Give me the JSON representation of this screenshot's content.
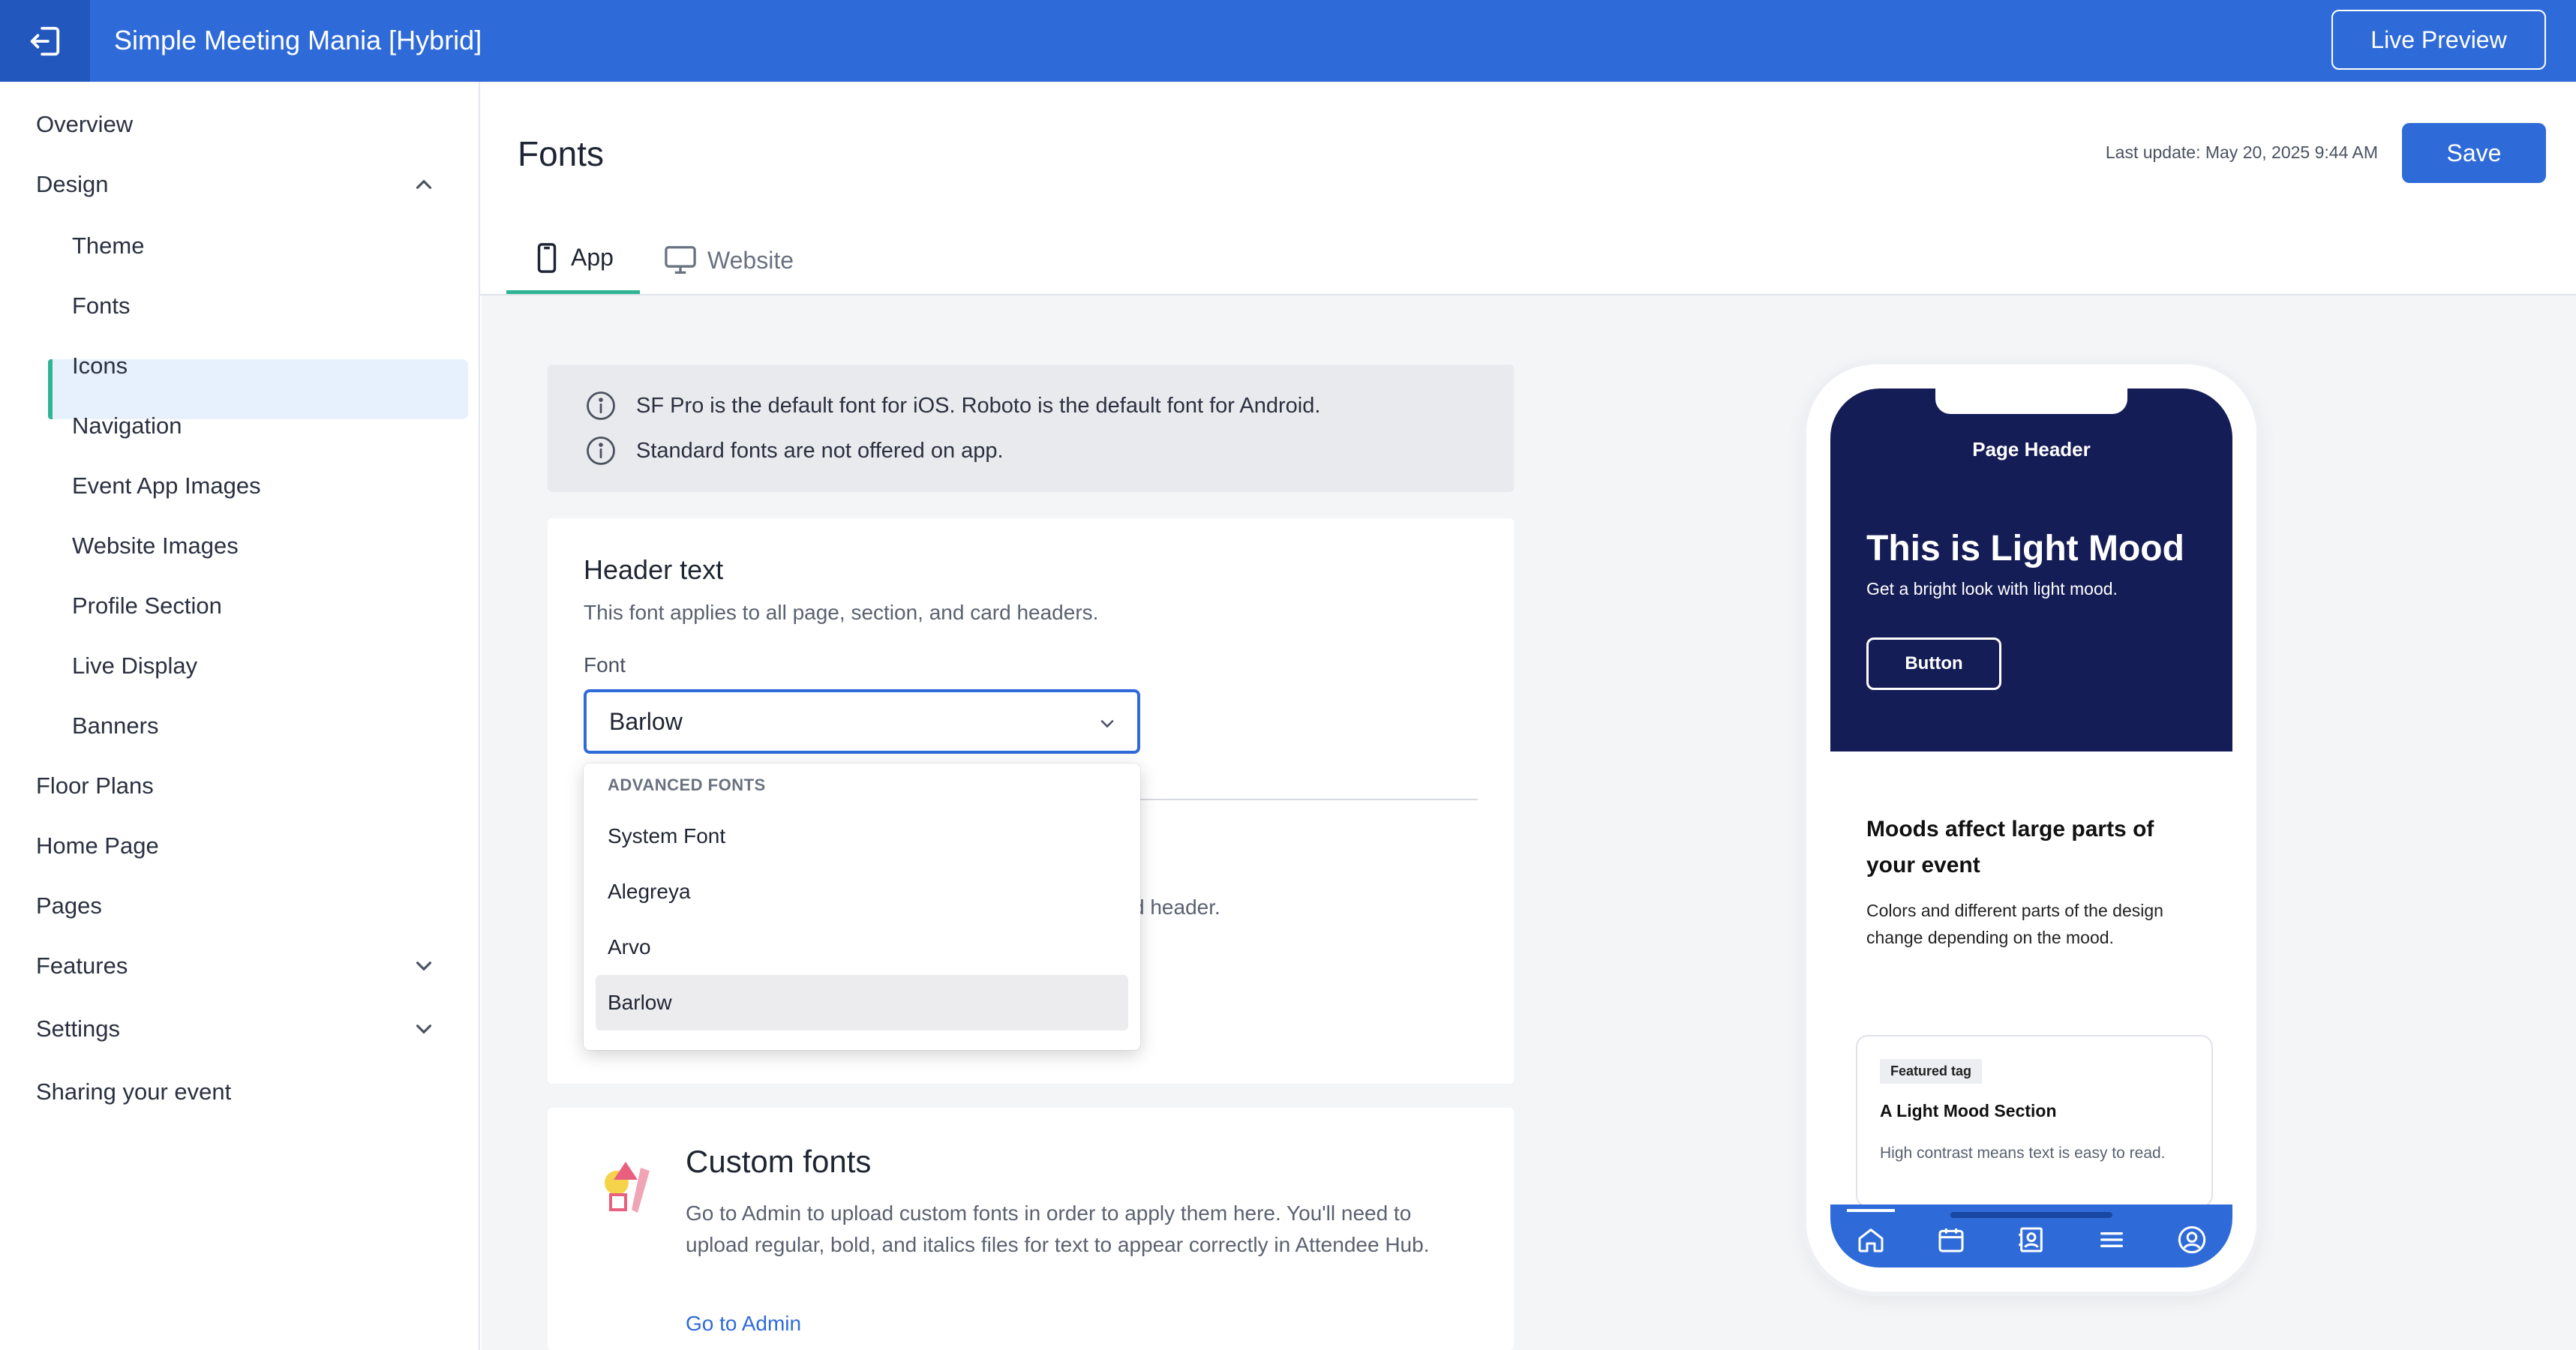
{
  "app": {
    "title": "Simple Meeting Mania [Hybrid]",
    "live_preview_label": "Live Preview"
  },
  "sidebar": {
    "items": [
      {
        "label": "Overview"
      },
      {
        "label": "Design"
      },
      {
        "label": "Theme"
      },
      {
        "label": "Fonts"
      },
      {
        "label": "Icons"
      },
      {
        "label": "Navigation"
      },
      {
        "label": "Event App Images"
      },
      {
        "label": "Website Images"
      },
      {
        "label": "Profile Section"
      },
      {
        "label": "Live Display"
      },
      {
        "label": "Banners"
      },
      {
        "label": "Floor Plans"
      },
      {
        "label": "Home Page"
      },
      {
        "label": "Pages"
      },
      {
        "label": "Features"
      },
      {
        "label": "Settings"
      },
      {
        "label": "Sharing your event"
      }
    ],
    "active": "Fonts"
  },
  "page": {
    "title": "Fonts",
    "last_update": "Last update: May 20, 2025 9:44 AM",
    "save_label": "Save",
    "tabs": [
      {
        "label": "App",
        "icon": "phone-icon",
        "active": true
      },
      {
        "label": "Website",
        "icon": "monitor-icon",
        "active": false
      }
    ]
  },
  "info": {
    "lines": [
      "SF Pro is the default font for iOS. Roboto is the default font for Android.",
      "Standard fonts are not offered on app."
    ]
  },
  "header_text": {
    "title": "Header text",
    "description": "This font applies to all page, section, and card headers.",
    "font_label": "Font",
    "selected_font": "Barlow",
    "hidden_text_fragment": "d header."
  },
  "dropdown": {
    "group_label": "ADVANCED FONTS",
    "options": [
      "System Font",
      "Alegreya",
      "Arvo",
      "Barlow"
    ],
    "selected": "Barlow"
  },
  "custom_fonts": {
    "title": "Custom fonts",
    "description": "Go to Admin to upload custom fonts in order to apply them here. You'll need to upload regular, bold, and italics files for text to appear correctly in Attendee Hub.",
    "link_label": "Go to Admin"
  },
  "preview": {
    "page_header": "Page Header",
    "hero_title": "This is Light Mood",
    "hero_subtitle": "Get a bright look with light mood.",
    "button_label": "Button",
    "moods_title": "Moods affect large parts of your event",
    "moods_text": "Colors and different parts of the design change depending on the mood.",
    "card_tag": "Featured tag",
    "card_title": "A Light Mood Section",
    "card_text": "High contrast means text is easy to read.",
    "nav_icons": [
      "home-icon",
      "calendar-icon",
      "contacts-icon",
      "menu-icon",
      "profile-icon"
    ]
  },
  "colors": {
    "brand_blue": "#2f6bd8",
    "accent_green": "#2fb596",
    "hero_navy": "#151d56"
  }
}
